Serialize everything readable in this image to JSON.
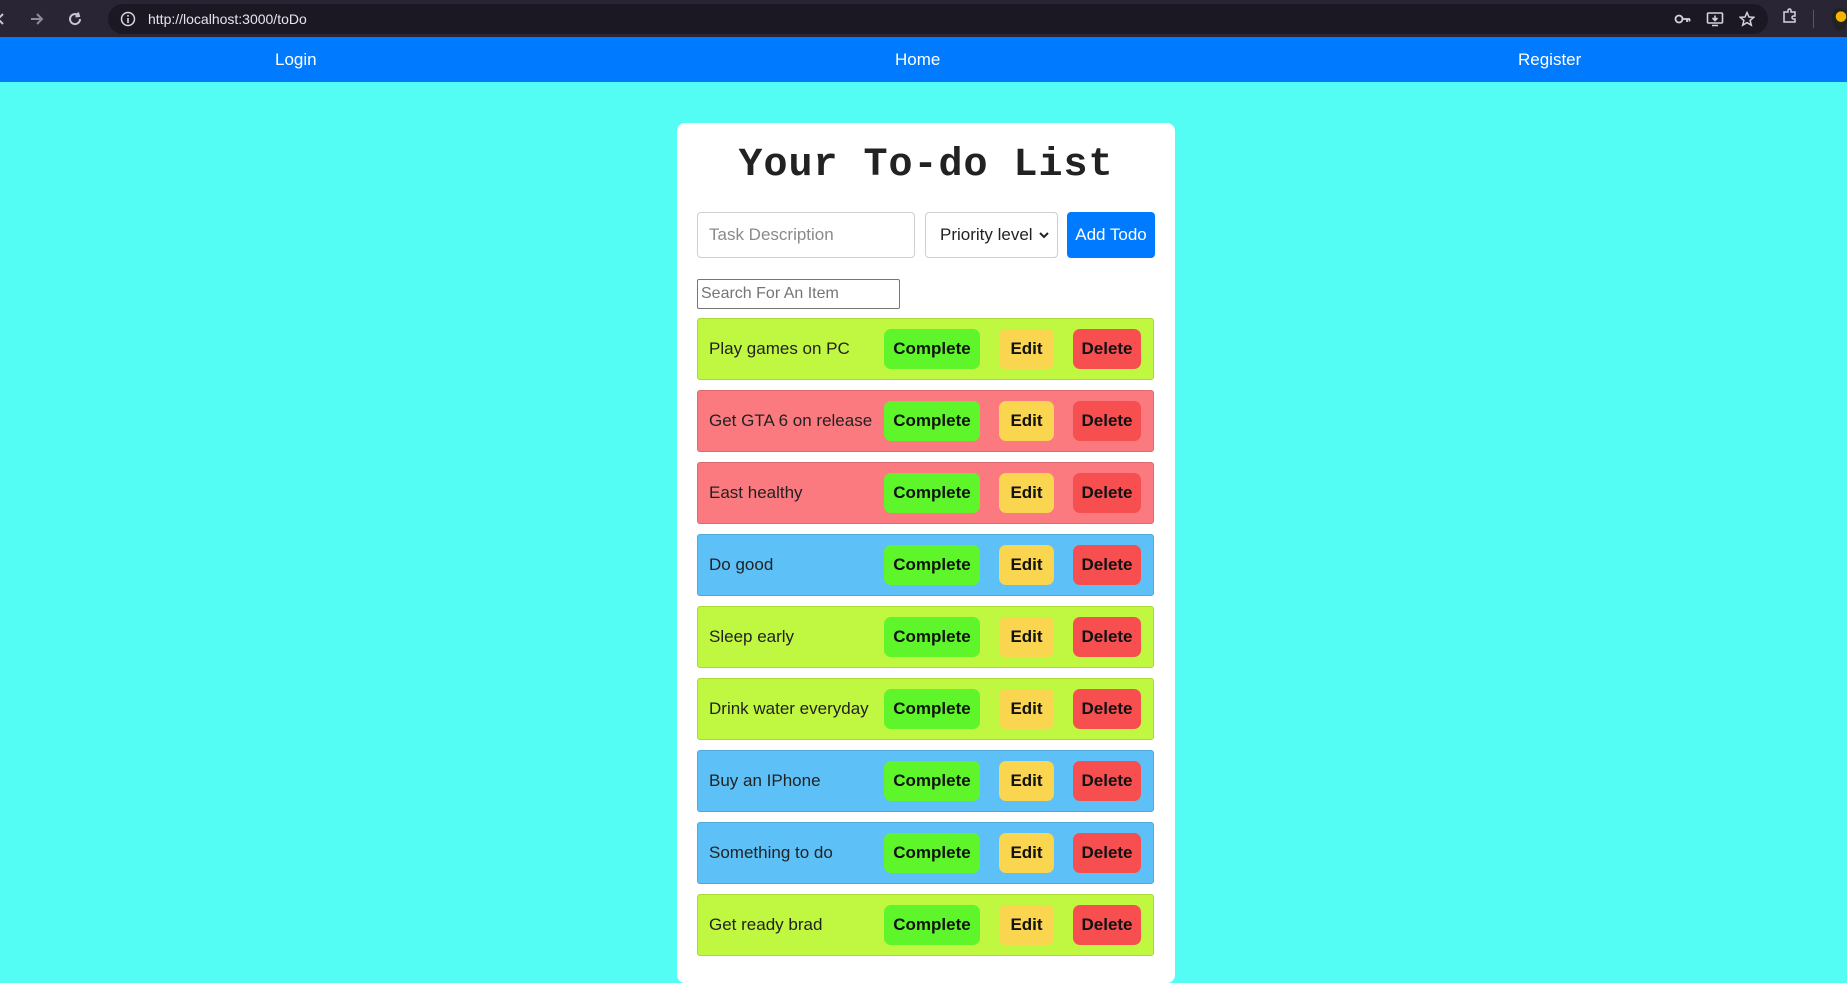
{
  "browser": {
    "url": "http://localhost:3000/toDo"
  },
  "nav": {
    "login": "Login",
    "home": "Home",
    "register": "Register"
  },
  "title": "Your To-do List",
  "add_form": {
    "task_placeholder": "Task Description",
    "priority_selected": "Priority level",
    "add_label": "Add Todo"
  },
  "search": {
    "placeholder": "Search For An Item"
  },
  "colors": {
    "page_bg": "#53fdf3",
    "nav_bg": "#007bff",
    "priority_low": "#c0f740",
    "priority_high": "#fb7a80",
    "priority_medium": "#5dc1f8",
    "complete_btn": "#5ef62a",
    "edit_btn": "#fad54f",
    "delete_btn": "#f74f4f"
  },
  "buttons": {
    "complete": "Complete",
    "edit": "Edit",
    "delete": "Delete"
  },
  "todos": [
    {
      "text": "Play games on PC",
      "color": "#c0f740"
    },
    {
      "text": "Get GTA 6 on release",
      "color": "#fb7a80"
    },
    {
      "text": "East healthy",
      "color": "#fb7a80"
    },
    {
      "text": "Do good",
      "color": "#5dc1f8"
    },
    {
      "text": "Sleep early",
      "color": "#c0f740"
    },
    {
      "text": "Drink water everyday",
      "color": "#c0f740"
    },
    {
      "text": "Buy an IPhone",
      "color": "#5dc1f8"
    },
    {
      "text": "Something to do",
      "color": "#5dc1f8"
    },
    {
      "text": "Get ready brad",
      "color": "#c0f740"
    }
  ]
}
